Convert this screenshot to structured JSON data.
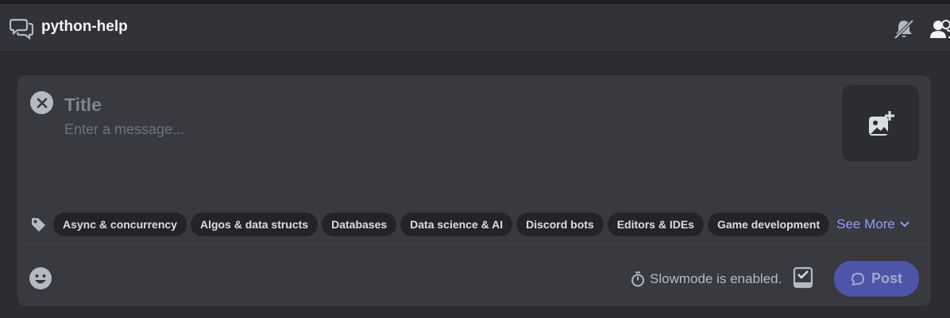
{
  "header": {
    "channel_name": "python-help",
    "channel_icon": "forum-icon",
    "actions": [
      "bell-slash-icon",
      "members-icon"
    ]
  },
  "composer": {
    "title_placeholder": "Title",
    "title_value": "",
    "message_placeholder": "Enter a message...",
    "message_value": "",
    "tags": [
      "Async & concurrency",
      "Algos & data structs",
      "Databases",
      "Data science & AI",
      "Discord bots",
      "Editors & IDEs",
      "Game development"
    ],
    "see_more_label": "See More",
    "slowmode_text": "Slowmode is enabled.",
    "post_label": "Post"
  },
  "colors": {
    "background": "#2b2d31",
    "composer": "#383a40",
    "tag": "#232428",
    "accent_link": "#949cf7",
    "post_button": "#4e55a8"
  }
}
